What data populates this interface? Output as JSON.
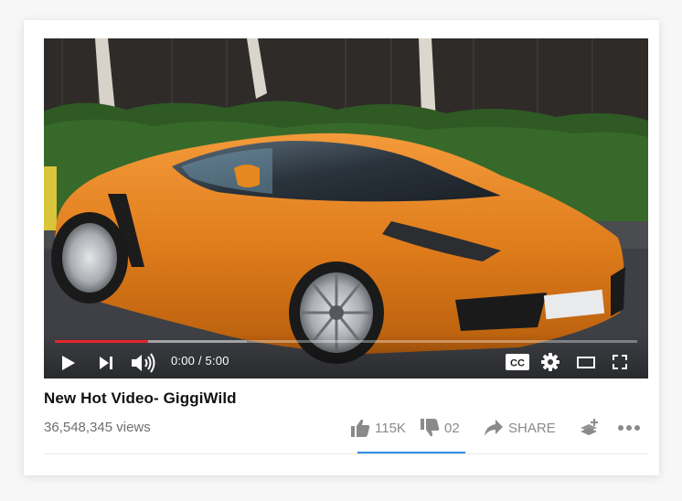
{
  "player": {
    "current_time": "0:00",
    "duration": "5:00",
    "time_display": "0:00 / 5:00",
    "played_fraction": 0.16,
    "buffered_fraction": 0.33,
    "progress_color": "#e3262b",
    "icons": [
      "play-icon",
      "next-icon",
      "volume-icon",
      "captions-icon",
      "settings-icon",
      "theater-mode-icon",
      "fullscreen-icon"
    ],
    "cc_label": "CC"
  },
  "video": {
    "title": "New Hot Video- GiggiWild",
    "views": "36,548,345 views"
  },
  "actions": {
    "likes": "115K",
    "dislikes": "02",
    "share": "SHARE",
    "icons": [
      "thumbs-up-icon",
      "thumbs-down-icon",
      "share-arrow-icon",
      "add-to-playlist-icon",
      "more-icon"
    ],
    "accent_color": "#2d8ee6"
  }
}
